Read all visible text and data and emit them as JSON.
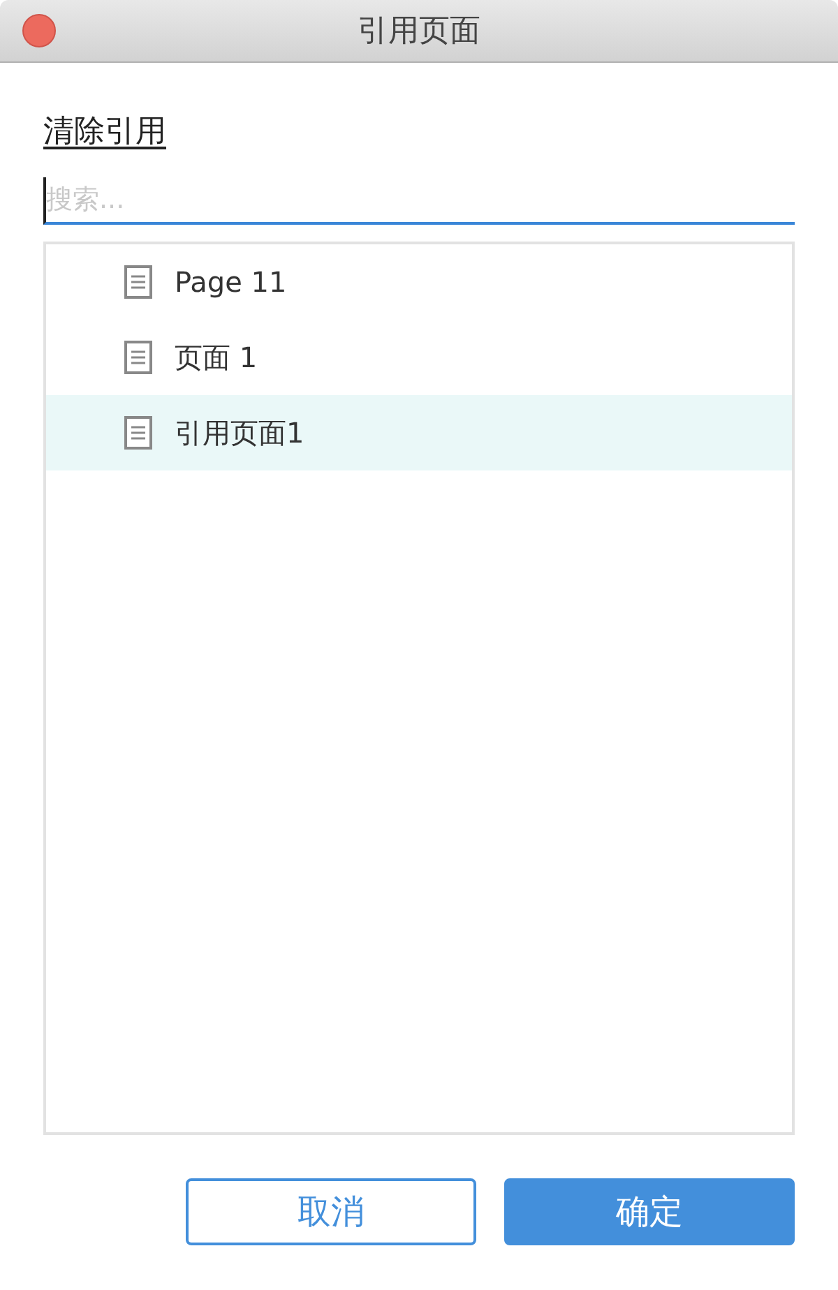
{
  "window": {
    "title": "引用页面"
  },
  "clear_link": "清除引用",
  "search": {
    "placeholder": "搜索..."
  },
  "pages": [
    {
      "label": "Page 11",
      "selected": false
    },
    {
      "label": "页面 1",
      "selected": false
    },
    {
      "label": "引用页面1",
      "selected": true
    }
  ],
  "buttons": [
    {
      "label": "取消",
      "kind": "secondary"
    },
    {
      "label": "确定",
      "kind": "primary"
    }
  ]
}
